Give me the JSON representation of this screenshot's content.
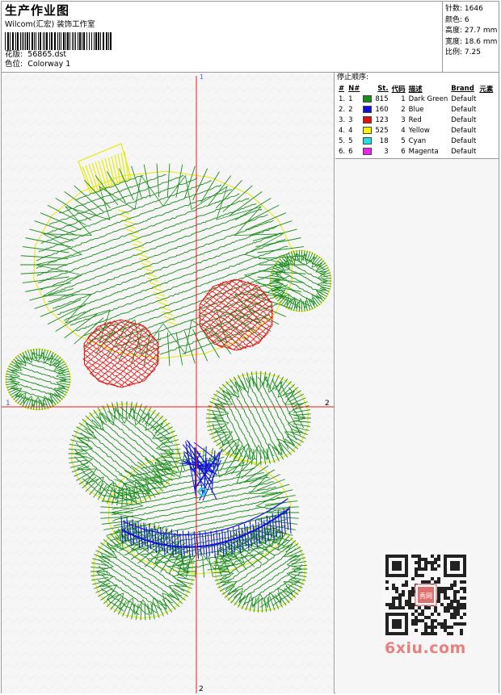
{
  "header": {
    "title": "生产作业图",
    "studio": "Wilcom(汇宏) 装饰工作室",
    "file_label": "花版:",
    "file_name": "56865.dst",
    "color_label": "色位:",
    "colorway": "Colorway 1"
  },
  "stats": [
    {
      "label": "针数:",
      "value": "1646"
    },
    {
      "label": "颜色:",
      "value": "6"
    },
    {
      "label": "高度:",
      "value": "27.7 mm"
    },
    {
      "label": "宽度:",
      "value": "18.6 mm"
    },
    {
      "label": "比例:",
      "value": "7.25"
    }
  ],
  "axes": {
    "top": "1",
    "bottom": "2",
    "left": "1",
    "right": "2"
  },
  "stop_sequence": {
    "title": "停止顺序:",
    "columns": [
      "#",
      "N#",
      "St.",
      "代码",
      "描述",
      "Brand",
      "元素"
    ],
    "rows": [
      {
        "idx": "1.",
        "n": "1",
        "color": "#1a8c1a",
        "st": "815",
        "code": "1",
        "desc": "Dark Green",
        "brand": "Default",
        "element": ""
      },
      {
        "idx": "2.",
        "n": "2",
        "color": "#1010d8",
        "st": "160",
        "code": "2",
        "desc": "Blue",
        "brand": "Default",
        "element": ""
      },
      {
        "idx": "3.",
        "n": "3",
        "color": "#e01010",
        "st": "123",
        "code": "3",
        "desc": "Red",
        "brand": "Default",
        "element": ""
      },
      {
        "idx": "4.",
        "n": "4",
        "color": "#f5f500",
        "st": "525",
        "code": "4",
        "desc": "Yellow",
        "brand": "Default",
        "element": ""
      },
      {
        "idx": "5.",
        "n": "5",
        "color": "#20e0e0",
        "st": "18",
        "code": "5",
        "desc": "Cyan",
        "brand": "Default",
        "element": ""
      },
      {
        "idx": "6.",
        "n": "6",
        "color": "#f020f0",
        "st": "3",
        "code": "6",
        "desc": "Magenta",
        "brand": "Default",
        "element": ""
      }
    ]
  },
  "colors": {
    "green": "#1a8c1a",
    "yellow": "#e8e800",
    "red": "#e01010",
    "blue": "#1010d8",
    "cyan": "#20c8e0",
    "crosshair": "#e02020",
    "watermark": "#e8807f"
  },
  "watermark": {
    "text": "6xiu.com",
    "qr_seal": "秀网"
  }
}
